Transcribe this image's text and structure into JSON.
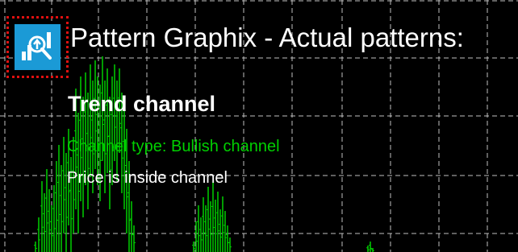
{
  "window": {
    "title": "Pattern Graphix - Actual patterns:"
  },
  "app_icon": {
    "name": "pattern-graphix-logo-icon",
    "background_color": "#1b9ad6",
    "highlight_border_color": "#e01010"
  },
  "pattern": {
    "name": "Trend channel",
    "channel_type": "Channel type: Bullish channel",
    "price_status": "Price is inside channel"
  },
  "colors": {
    "background": "#000000",
    "grid": "#bfbfbf",
    "candles": "#00d000",
    "text_primary": "#ffffff",
    "text_accent": "#00d000"
  }
}
